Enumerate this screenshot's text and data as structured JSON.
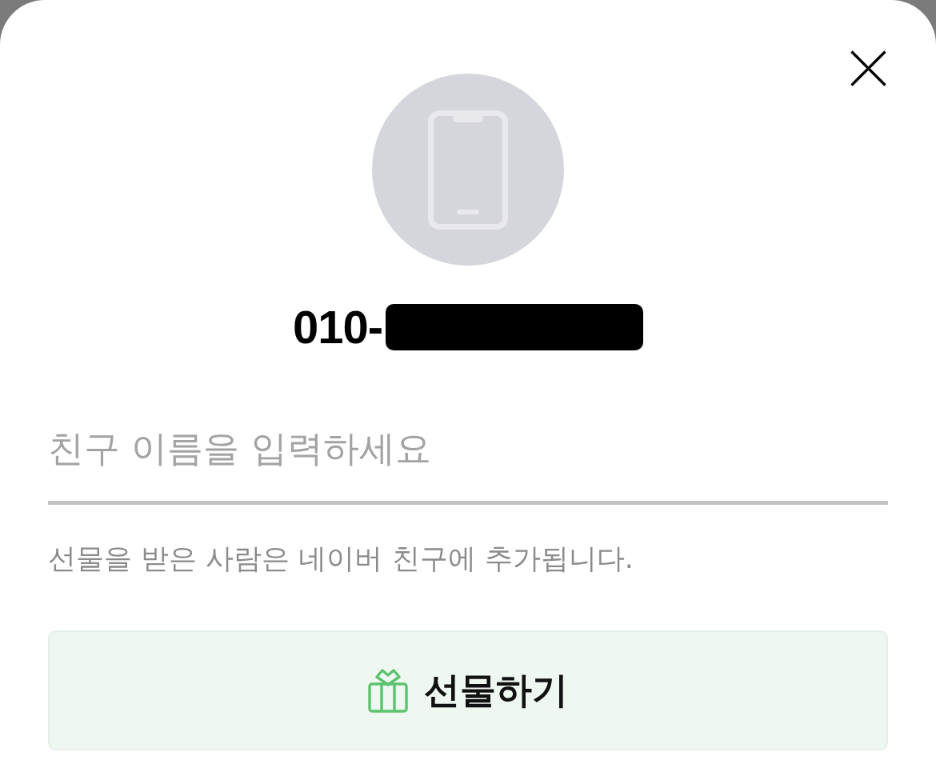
{
  "recipient": {
    "phone": "010-",
    "redacted": true
  },
  "name_field": {
    "placeholder": "친구 이름을 입력하세요"
  },
  "notice": "선물을 받은 사람은 네이버 친구에 추가됩니다.",
  "gift_button": {
    "label": "선물하기"
  }
}
